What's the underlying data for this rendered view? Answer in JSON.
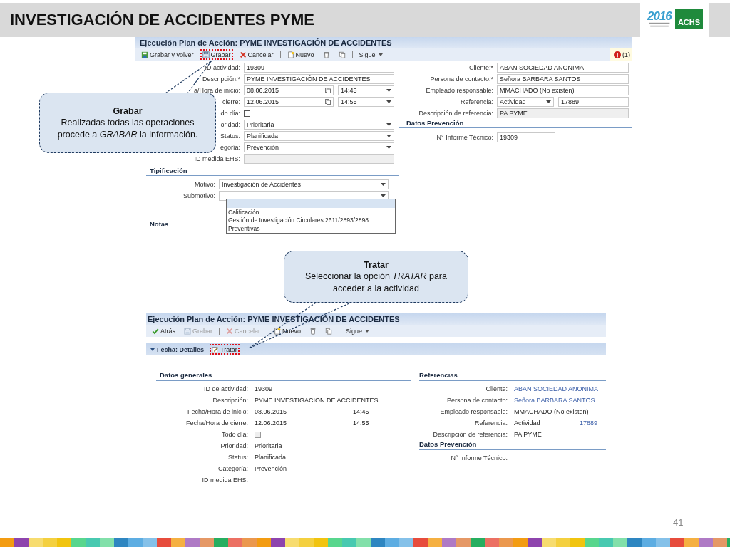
{
  "slide": {
    "title": "INVESTIGACIÓN DE ACCIDENTES PYME",
    "page_number": "41"
  },
  "logo": {
    "year": "2016",
    "brand": "ACHS"
  },
  "edit_screen": {
    "title": "Ejecución Plan de Acción: PYME INVESTIGACIÓN DE ACCIDENTES",
    "toolbar": [
      {
        "kind": "save-back",
        "label": "Grabar y volver",
        "disabled": false,
        "highlighted": false
      },
      {
        "kind": "save",
        "label": "Grabar",
        "disabled": false,
        "highlighted": true
      },
      {
        "kind": "cancel",
        "label": "Cancelar",
        "disabled": false,
        "highlighted": false
      },
      {
        "kind": "separator"
      },
      {
        "kind": "new",
        "label": "Nuevo",
        "disabled": false,
        "highlighted": false
      },
      {
        "kind": "trash",
        "disabled": false,
        "highlighted": false
      },
      {
        "kind": "copy",
        "disabled": false,
        "highlighted": false
      },
      {
        "kind": "separator"
      },
      {
        "kind": "menu",
        "label": "Sigue",
        "disabled": false,
        "highlighted": false
      }
    ],
    "alert_count": "(1)",
    "general": [
      {
        "kind": "text",
        "label": "ID actividad:",
        "value": "19309"
      },
      {
        "kind": "text",
        "label": "Descripción:*",
        "value": "PYME INVESTIGACIÓN DE ACCIDENTES"
      },
      {
        "kind": "datetime",
        "label": "a/Hora de inicio:",
        "value": "08.06.2015",
        "time": "14:45"
      },
      {
        "kind": "datetime",
        "label": "cierre:",
        "value": "12.06.2015",
        "time": "14:55"
      },
      {
        "kind": "checkbox",
        "label": "do día:",
        "checked": false
      },
      {
        "kind": "select",
        "label": "oridad:",
        "value": "Prioritaria"
      },
      {
        "kind": "select",
        "label": "Status:",
        "value": "Planificada"
      },
      {
        "kind": "select",
        "label": "egoría:",
        "value": "Prevención"
      },
      {
        "kind": "readonly",
        "label": "ID medida EHS:"
      }
    ],
    "typing": {
      "heading": "Tipificación",
      "rows": [
        {
          "kind": "select",
          "label": "Motivo:",
          "value": "Investigación de Accidentes"
        },
        {
          "kind": "select",
          "label": "Submotivo:",
          "expanded": true
        }
      ],
      "options": [
        {
          "label": "Calificación",
          "selected": false
        },
        {
          "label": "Gestión de Investigación Circulares 2611/2893/2898",
          "selected": false
        },
        {
          "label": "Preventivas",
          "selected": false
        }
      ]
    },
    "notes_heading": "Notas",
    "references": [
      {
        "kind": "text",
        "label": "Cliente:*",
        "value": "ABAN SOCIEDAD ANONIMA"
      },
      {
        "kind": "text",
        "label": "Persona de contacto:*",
        "value": "Señora BARBARA SANTOS"
      },
      {
        "kind": "text",
        "label": "Empleado responsable:",
        "value": "MMACHADO (No existen)"
      },
      {
        "kind": "reference",
        "label": "Referencia:",
        "value": "Actividad",
        "number": "17889"
      },
      {
        "kind": "readonly",
        "label": "Descripción de referencia:",
        "value": "PA PYME"
      }
    ],
    "prevention": {
      "heading": "Datos Prevención",
      "rows": [
        {
          "kind": "short",
          "label": "N° Informe Técnico:",
          "value": "19309"
        }
      ]
    }
  },
  "detail_screen": {
    "title": "Ejecución Plan de Acción: PYME INVESTIGACIÓN DE ACCIDENTES",
    "toolbar": [
      {
        "kind": "check",
        "label": "Atrás",
        "disabled": false,
        "highlighted": false
      },
      {
        "kind": "save",
        "label": "Grabar",
        "disabled": true,
        "highlighted": false
      },
      {
        "kind": "separator"
      },
      {
        "kind": "cancel",
        "label": "Cancelar",
        "disabled": true,
        "highlighted": false
      },
      {
        "kind": "separator"
      },
      {
        "kind": "new",
        "label": "Nuevo",
        "disabled": false,
        "highlighted": false
      },
      {
        "kind": "trash",
        "disabled": false,
        "highlighted": false
      },
      {
        "kind": "copy",
        "disabled": false,
        "highlighted": false
      },
      {
        "kind": "separator"
      },
      {
        "kind": "menu",
        "label": "Sigue",
        "disabled": false,
        "highlighted": false
      }
    ],
    "section": {
      "label": "Fecha: Detalles",
      "expanded": true
    },
    "action": {
      "label": "Tratar",
      "highlighted": true
    },
    "general": {
      "heading": "Datos generales",
      "rows": [
        {
          "kind": "text",
          "label": "ID de actividad:",
          "value": "19309"
        },
        {
          "kind": "text",
          "label": "Descripción:",
          "value": "PYME INVESTIGACIÓN DE ACCIDENTES"
        },
        {
          "kind": "datetime",
          "label": "Fecha/Hora de inicio:",
          "value": "08.06.2015",
          "time": "14:45"
        },
        {
          "kind": "datetime",
          "label": "Fecha/Hora de cierre:",
          "value": "12.06.2015",
          "time": "14:55"
        },
        {
          "kind": "checkbox",
          "label": "Todo día:",
          "checked": false
        },
        {
          "kind": "text",
          "label": "Prioridad:",
          "value": "Prioritaria"
        },
        {
          "kind": "text",
          "label": "Status:",
          "value": "Planificada"
        },
        {
          "kind": "text",
          "label": "Categoría:",
          "value": "Prevención"
        },
        {
          "label": "ID medida EHS:"
        }
      ]
    },
    "references": {
      "heading": "Referencias",
      "rows": [
        {
          "kind": "link",
          "label": "Cliente:",
          "value": "ABAN SOCIEDAD ANONIMA"
        },
        {
          "kind": "link",
          "label": "Persona de contacto:",
          "value": "Señora BARBARA SANTOS"
        },
        {
          "kind": "text",
          "label": "Empleado responsable:",
          "value": "MMACHADO (No existen)"
        },
        {
          "kind": "reference",
          "label": "Referencia:",
          "value": "Actividad",
          "number": "17889"
        },
        {
          "kind": "text",
          "label": "Descripción de referencia:",
          "value": "PA PYME"
        }
      ]
    },
    "prevention": {
      "heading": "Datos Prevención",
      "rows": [
        {
          "label": "N° Informe Técnico:"
        }
      ]
    }
  },
  "callouts": [
    {
      "title": "Grabar",
      "text": "Realizadas todas las operaciones procede a *GRABAR* la información."
    },
    {
      "title": "Tratar",
      "text": "Seleccionar la opción *TRATAR* para acceder a la actividad"
    }
  ]
}
